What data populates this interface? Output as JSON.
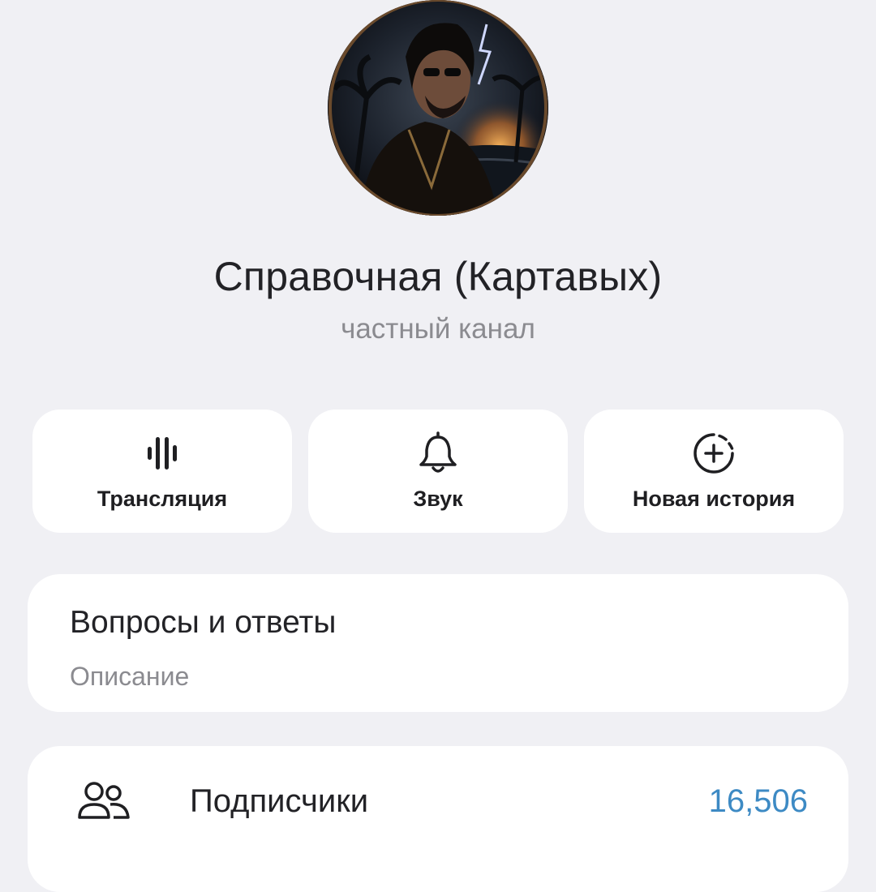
{
  "profile": {
    "name": "Справочная (Картавых)",
    "type_label": "частный канал"
  },
  "actions": [
    {
      "label": "Трансляция",
      "icon": "broadcast-bars-icon"
    },
    {
      "label": "Звук",
      "icon": "bell-icon"
    },
    {
      "label": "Новая история",
      "icon": "new-story-plus-icon"
    }
  ],
  "description_card": {
    "text": "Вопросы и ответы",
    "caption": "Описание"
  },
  "subscribers_row": {
    "icon": "people-icon",
    "label": "Подписчики",
    "count": "16,506"
  },
  "colors": {
    "background": "#f0f0f4",
    "card": "#ffffff",
    "accent_count": "#3d8ac4",
    "secondary_text": "#8b8b90"
  }
}
